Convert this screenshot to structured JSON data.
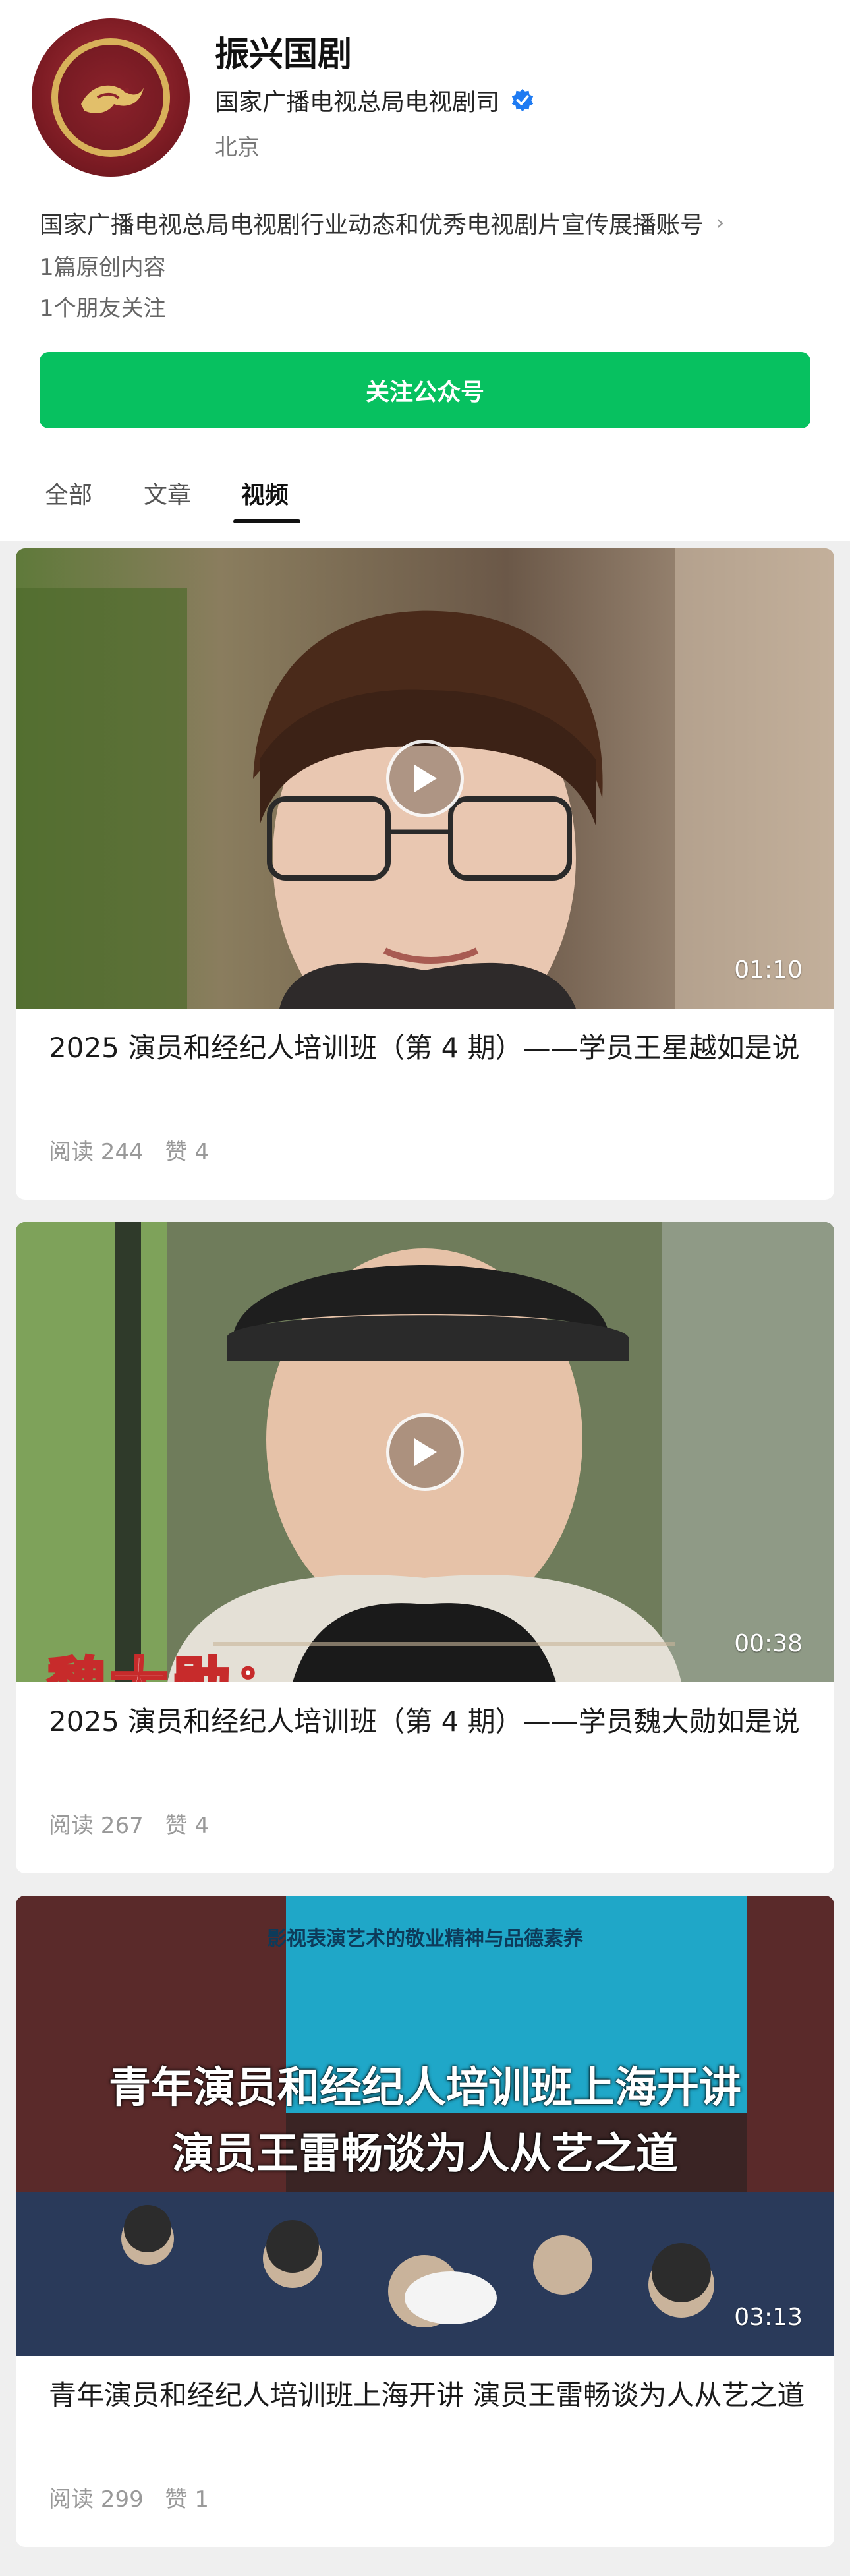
{
  "account": {
    "name": "振兴国剧",
    "org": "国家广播电视总局电视剧司",
    "location": "北京",
    "description": "国家广播电视总局电视剧行业动态和优秀电视剧片宣传展播账号",
    "original_count": "1篇原创内容",
    "friends_follow": "1个朋友关注",
    "follow_label": "关注公众号",
    "verified_color": "#1f7bf2",
    "accent": "#07c160"
  },
  "tabs": [
    {
      "label": "全部"
    },
    {
      "label": "文章"
    },
    {
      "label": "视频",
      "active": true
    }
  ],
  "videos": [
    {
      "title": "2025 演员和经纪人培训班（第 4 期）——学员王星越如是说",
      "duration": "01:10",
      "reads": "阅读 244",
      "likes": "赞 4"
    },
    {
      "title": "2025 演员和经纪人培训班（第 4 期）——学员魏大勋如是说",
      "duration": "00:38",
      "reads": "阅读 267",
      "likes": "赞 4",
      "caption_text": "魏大勋："
    },
    {
      "title": "青年演员和经纪人培训班上海开讲 演员王雷畅谈为人从艺之道",
      "duration": "03:13",
      "reads": "阅读 299",
      "likes": "赞 1",
      "banner_text": "影视表演艺术的敬业精神与品德素养",
      "overlay_line1": "青年演员和经纪人培训班上海开讲",
      "overlay_line2": "演员王雷畅谈为人从艺之道"
    }
  ]
}
